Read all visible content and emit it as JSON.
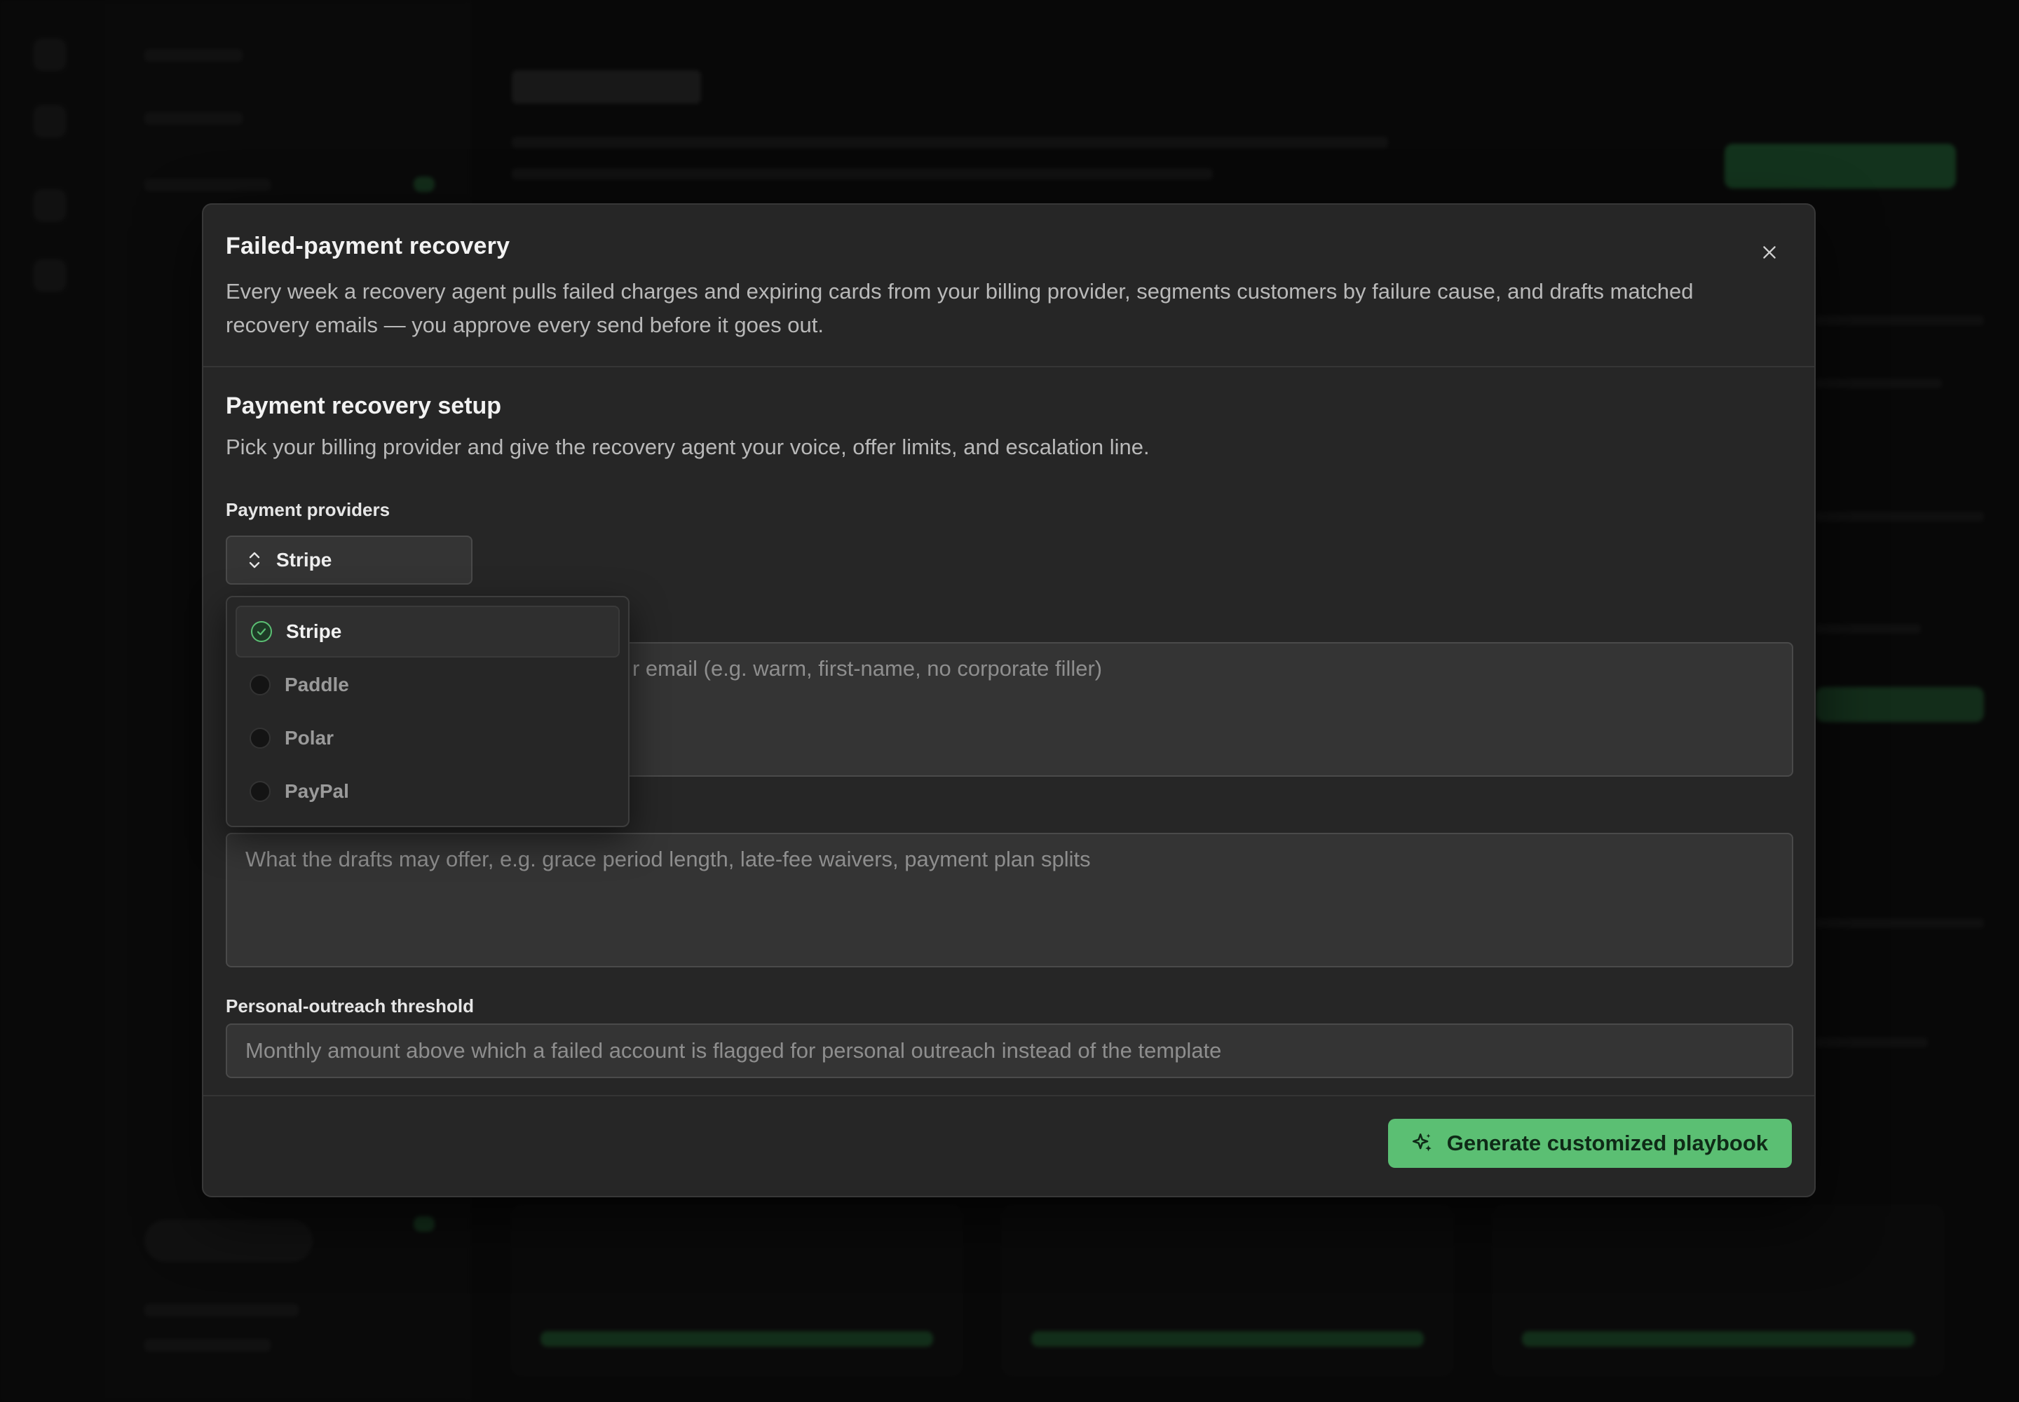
{
  "modal": {
    "title": "Failed-payment recovery",
    "description": "Every week a recovery agent pulls failed charges and expiring cards from your billing provider, segments customers by failure cause, and drafts matched recovery emails — you approve every send before it goes out.",
    "close_icon": "close-icon"
  },
  "setup": {
    "title": "Payment recovery setup",
    "description": "Pick your billing provider and give the recovery agent your voice, offer limits, and escalation line."
  },
  "providers": {
    "label": "Payment providers",
    "selected": "Stripe",
    "icon": "chevron-up-down-icon",
    "options": [
      {
        "label": "Stripe",
        "checked": true
      },
      {
        "label": "Paddle",
        "checked": false
      },
      {
        "label": "Polar",
        "checked": false
      },
      {
        "label": "PayPal",
        "checked": false
      }
    ]
  },
  "voice": {
    "placeholder_visible": "r email (e.g. warm, first-name, no corporate filler)"
  },
  "offers": {
    "placeholder": "What the drafts may offer, e.g. grace period length, late-fee waivers, payment plan splits"
  },
  "threshold": {
    "label": "Personal-outreach threshold",
    "placeholder": "Monthly amount above which a failed account is flagged for personal outreach instead of the template"
  },
  "footer": {
    "generate_label": "Generate customized playbook",
    "generate_icon": "sparkles-icon"
  },
  "colors": {
    "accent": "#5bbf73",
    "modal_bg": "#262626",
    "field_bg": "#343434"
  }
}
